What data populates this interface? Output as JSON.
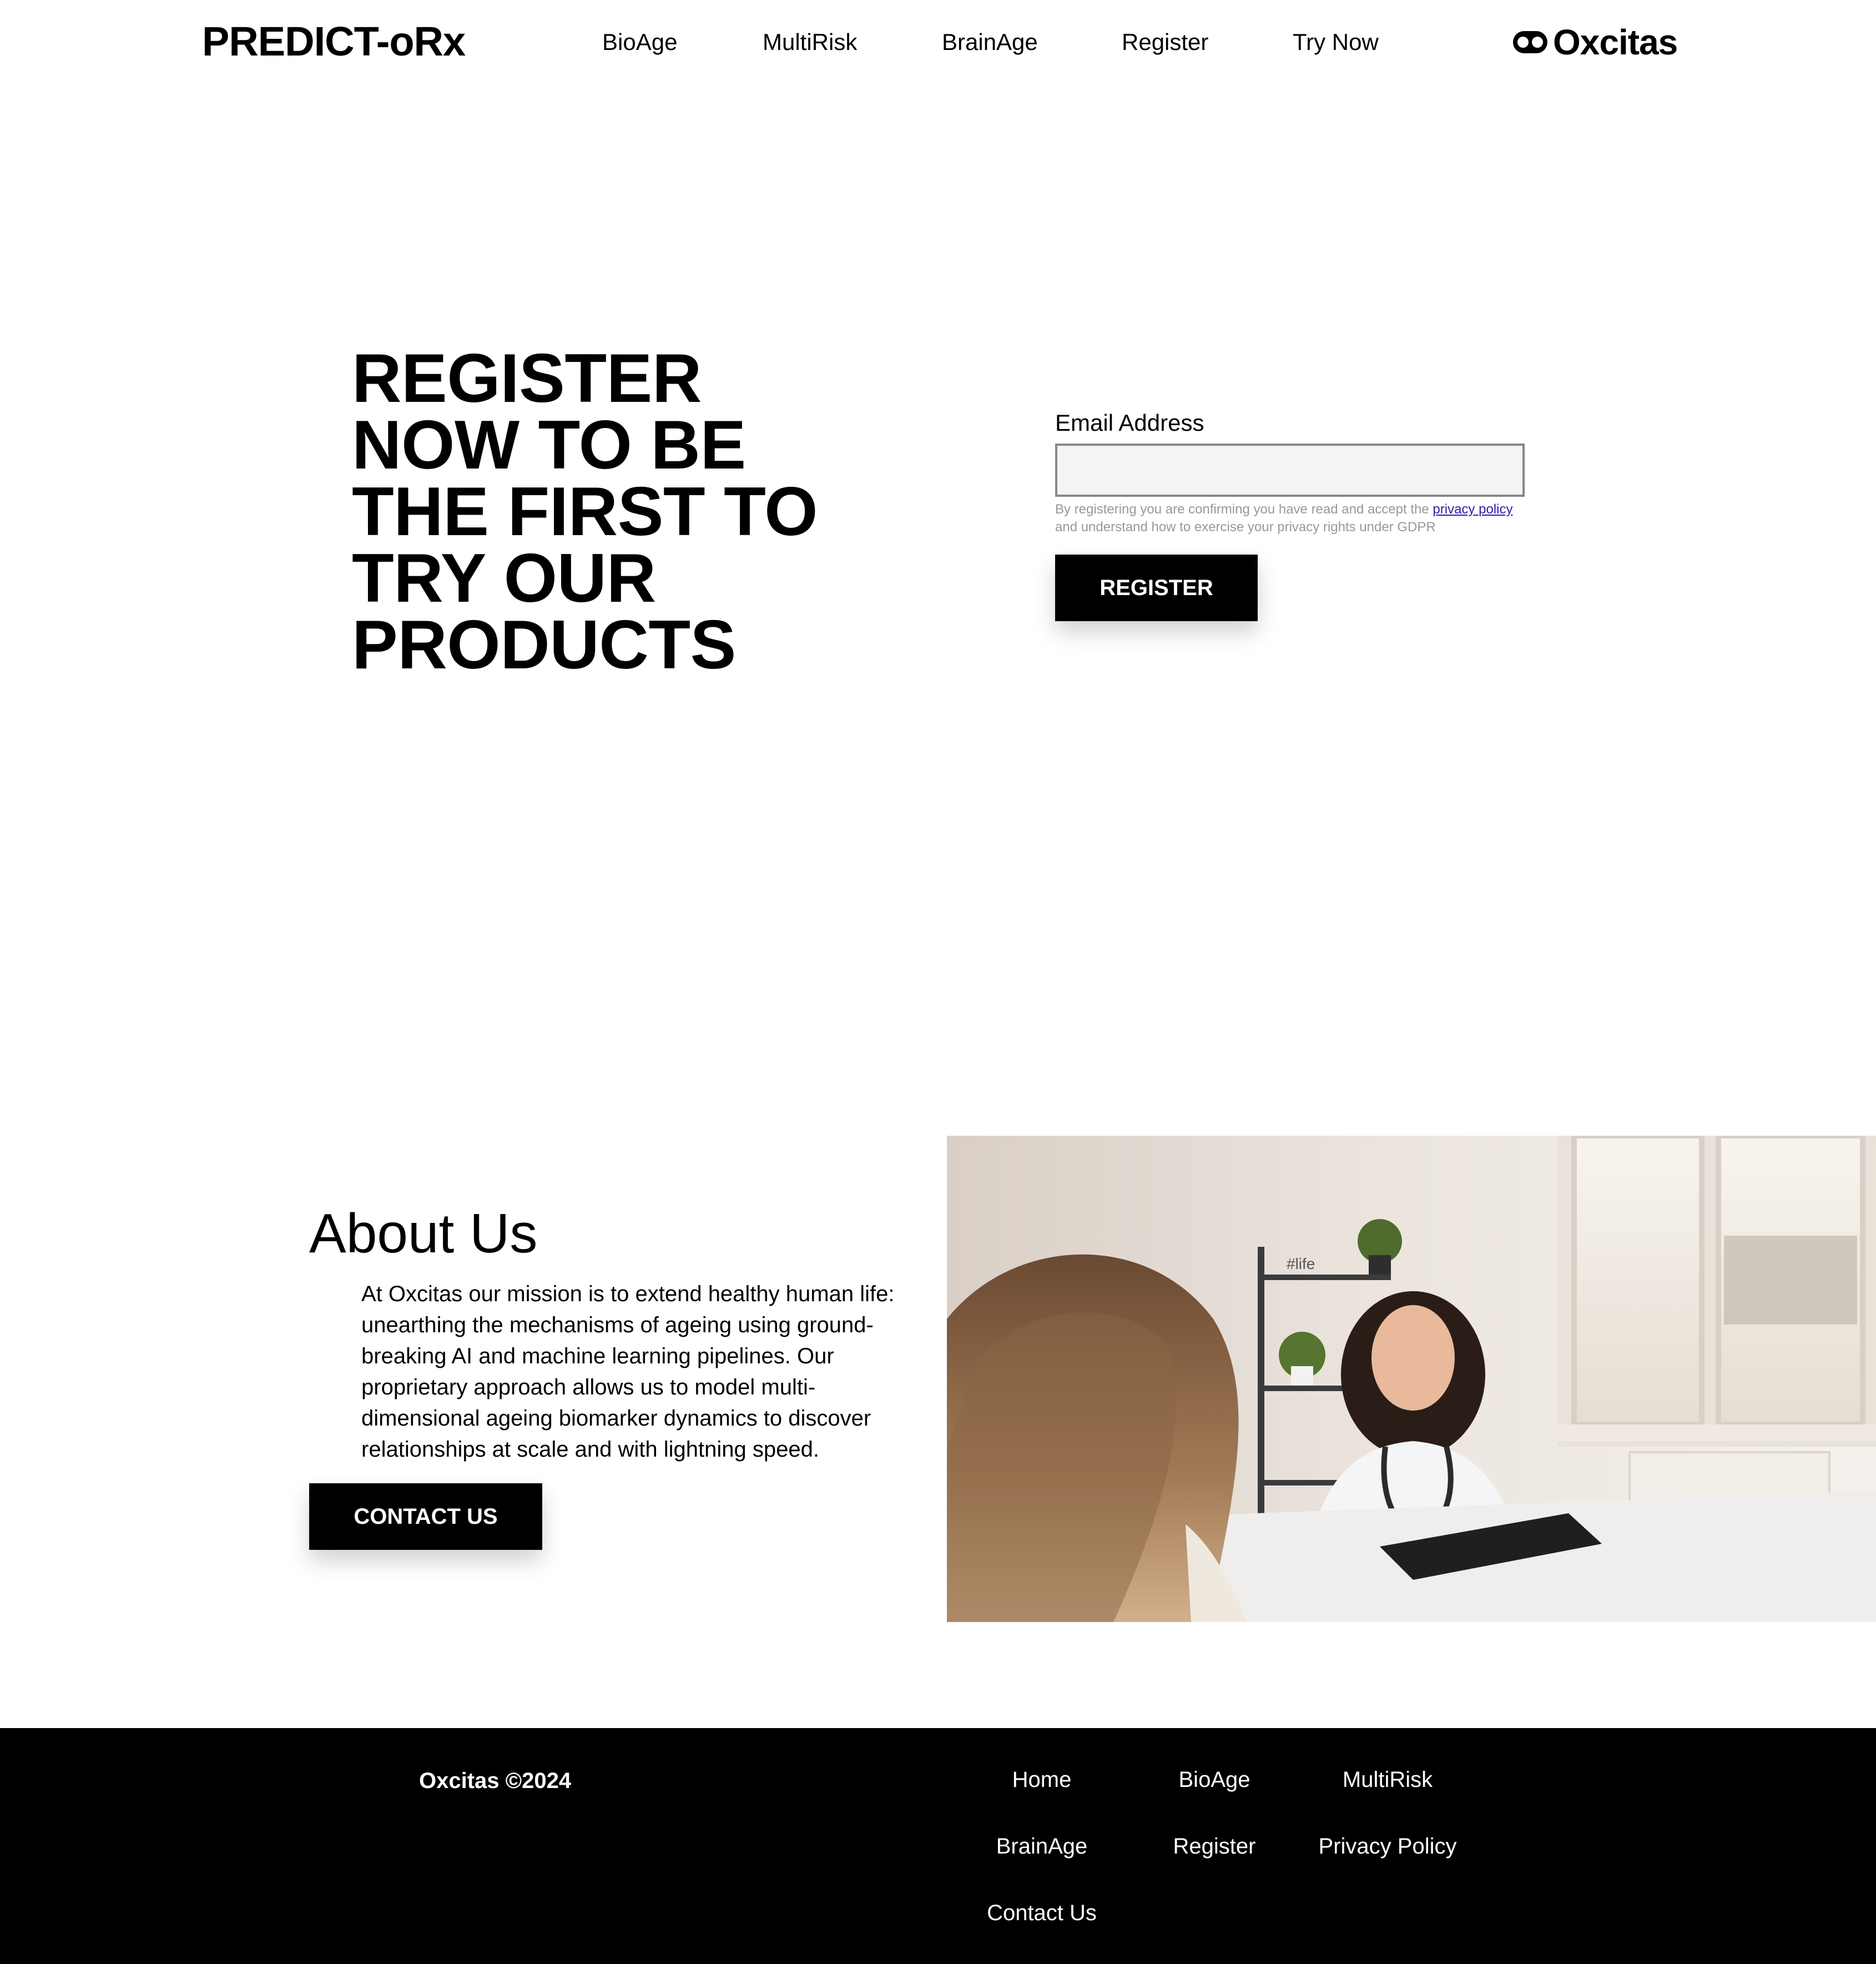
{
  "header": {
    "brand": "PREDICT-oRx",
    "nav": [
      "BioAge",
      "MultiRisk",
      "BrainAge",
      "Register",
      "Try Now"
    ],
    "logo_text": "Oxcitas"
  },
  "hero": {
    "title": "REGISTER NOW TO BE THE FIRST TO TRY OUR PRODUCTS",
    "email_label": "Email Address",
    "email_value": "",
    "consent_before": "By registering you are confirming you have read and accept the",
    "consent_link": "privacy policy",
    "consent_after": "and understand how to exercise your privacy rights under GDPR",
    "register_button": "REGISTER"
  },
  "about": {
    "title": "About Us",
    "text": "At Oxcitas our mission is to extend healthy human life: unearthing the mechanisms of ageing using ground-breaking AI and machine learning pipelines. Our proprietary approach allows us to model multi-dimensional ageing biomarker dynamics to discover relationships at scale and with lightning speed.",
    "contact_button": "CONTACT US",
    "photo_sign": "#life"
  },
  "footer": {
    "copyright": "Oxcitas ©2024",
    "links": [
      "Home",
      "BioAge",
      "MultiRisk",
      "BrainAge",
      "Register",
      "Privacy Policy",
      "Contact Us"
    ]
  }
}
